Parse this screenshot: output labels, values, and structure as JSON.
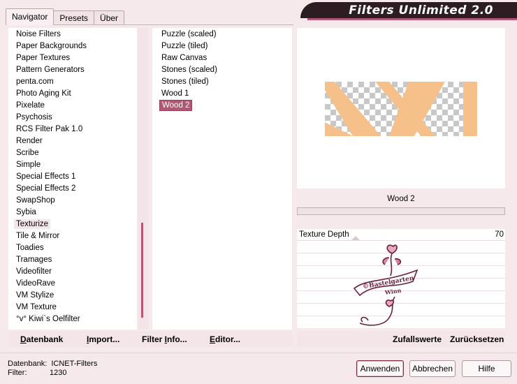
{
  "app_title": "Filters Unlimited 2.0",
  "tabs": [
    {
      "label": "Navigator",
      "active": true
    },
    {
      "label": "Presets",
      "active": false
    },
    {
      "label": "Über",
      "active": false
    }
  ],
  "categories": [
    "Noise Filters",
    "Paper Backgrounds",
    "Paper Textures",
    "Pattern Generators",
    "penta.com",
    "Photo Aging Kit",
    "Pixelate",
    "Psychosis",
    "RCS Filter Pak 1.0",
    "Render",
    "Scribe",
    "Simple",
    "Special Effects 1",
    "Special Effects 2",
    "SwapShop",
    "Sybia",
    "Texturize",
    "Tile & Mirror",
    "Toadies",
    "Tramages",
    "Videofilter",
    "VideoRave",
    "VM Stylize",
    "VM Texture",
    "°v° Kiwi`s Oelfilter"
  ],
  "selected_category": "Texturize",
  "filters": [
    "Puzzle (scaled)",
    "Puzzle (tiled)",
    "Raw Canvas",
    "Stones (scaled)",
    "Stones (tiled)",
    "Wood 1",
    "Wood 2"
  ],
  "selected_filter": "Wood 2",
  "filter_name_display": "Wood 2",
  "controls": [
    {
      "label": "Texture Depth",
      "value": "70"
    }
  ],
  "watermark_text": [
    "©Bastelgarten",
    "Winn"
  ],
  "links_left": [
    {
      "label": "Datenbank",
      "underline": "D",
      "rest": "atenbank"
    },
    {
      "label": "Import...",
      "underline": "I",
      "rest": "mport..."
    },
    {
      "label": "Filter Info...",
      "pre": "Filter ",
      "underline": "I",
      "rest": "nfo..."
    },
    {
      "label": "Editor...",
      "underline": "E",
      "rest": "ditor..."
    }
  ],
  "links_right": [
    {
      "label": "Zufallswerte"
    },
    {
      "label": "Zurücksetzen"
    }
  ],
  "status": {
    "db_label": "Datenbank:",
    "db_value": "ICNET-Filters",
    "filter_label": "Filter:",
    "filter_value": "1230"
  },
  "buttons": {
    "apply": "Anwenden",
    "cancel": "Abbrechen",
    "help": "Hilfe"
  },
  "colors": {
    "accent": "#b05873",
    "banner": "#2b1d22",
    "panel_bg": "#f6e9ec",
    "wood": "#f5c089"
  }
}
